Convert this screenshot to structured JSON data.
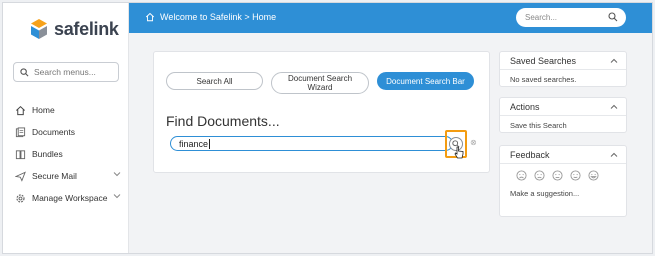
{
  "app": {
    "brand": "safelink"
  },
  "sidebar": {
    "search_placeholder": "Search menus...",
    "items": [
      {
        "label": "Home",
        "icon": "home-icon"
      },
      {
        "label": "Documents",
        "icon": "documents-icon"
      },
      {
        "label": "Bundles",
        "icon": "bundles-icon"
      },
      {
        "label": "Secure Mail",
        "icon": "send-icon",
        "expandable": true
      },
      {
        "label": "Manage Workspace",
        "icon": "gear-icon",
        "expandable": true
      }
    ]
  },
  "header": {
    "breadcrumb": "Welcome to Safelink > Home",
    "search_placeholder": "Search..."
  },
  "main": {
    "tabs": [
      {
        "label": "Search All",
        "active": false
      },
      {
        "label": "Document Search Wizard",
        "active": false
      },
      {
        "label": "Document Search Bar",
        "active": true
      }
    ],
    "title": "Find Documents...",
    "search_value": "finance"
  },
  "panels": {
    "saved": {
      "title": "Saved Searches",
      "text": "No saved searches."
    },
    "actions": {
      "title": "Actions",
      "text": "Save this Search"
    },
    "feedback": {
      "title": "Feedback",
      "text": "Make a suggestion..."
    }
  },
  "colors": {
    "accent": "#2e8fd6",
    "highlight": "#f39c12"
  }
}
